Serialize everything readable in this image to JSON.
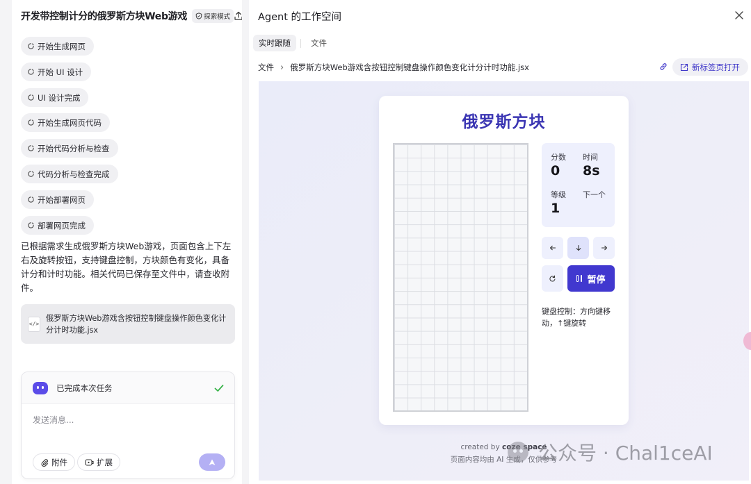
{
  "left": {
    "title": "开发带控制计分的俄罗斯方块Web游戏",
    "mode_badge": "探索模式",
    "steps": [
      "开始生成网页",
      "开始 UI 设计",
      "UI 设计完成",
      "开始生成网页代码",
      "开始代码分析与检查",
      "代码分析与检查完成",
      "开始部署网页",
      "部署网页完成"
    ],
    "summary": "已根据需求生成俄罗斯方块Web游戏，页面包含上下左右及旋转按钮，支持键盘控制，方块颜色有变化，具备计分和计时功能。相关代码已保存至文件中，请查收附件。",
    "attachment": {
      "icon": "code-file-icon",
      "icon_text": "</>",
      "name": "俄罗斯方块Web游戏含按钮控制键盘操作颜色变化计分计时功能.jsx"
    },
    "chat": {
      "task_status": "已完成本次任务",
      "input_placeholder": "发送消息...",
      "attach_label": "附件",
      "expand_label": "扩展"
    }
  },
  "right": {
    "title": "Agent 的工作空间",
    "tabs": [
      "实时跟随",
      "文件"
    ],
    "active_tab": 0,
    "path": {
      "root": "文件",
      "file": "俄罗斯方块Web游戏含按钮控制键盘操作颜色变化计分计时功能.jsx"
    },
    "open_in_tab": "新标签页打开"
  },
  "game": {
    "title": "俄罗斯方块",
    "score_label": "分数",
    "score": "0",
    "time_label": "时间",
    "time": "8s",
    "level_label": "等级",
    "level": "1",
    "next_label": "下一个",
    "pause_label": "暂停",
    "keyboard_hint": "键盘控制：方向键移动，↑键旋转",
    "board": {
      "columns": 10,
      "rows": 20
    }
  },
  "footer": {
    "created_by": "created by ",
    "brand": "coze space",
    "disclaimer": "页面内容均由 AI 生成，仅供参考"
  },
  "watermark": "公众号 · Chal1ceAI",
  "colors": {
    "accent": "#4138cf",
    "title_purple": "#3b36b3",
    "panel_tint": "#eef0fd",
    "send_button": "#b4b0f4"
  }
}
